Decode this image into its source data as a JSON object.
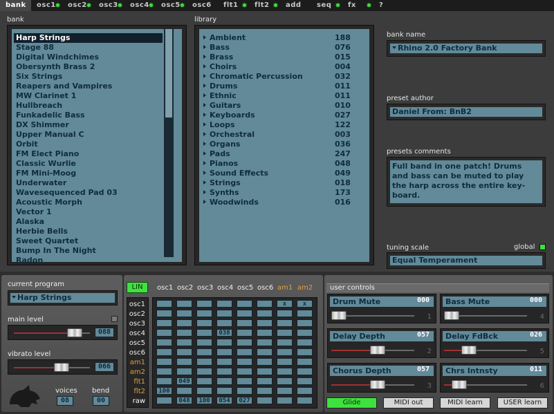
{
  "tabs": [
    {
      "label": "bank",
      "active": true,
      "led": false
    },
    {
      "label": "osc1",
      "active": false,
      "led": true
    },
    {
      "label": "osc2",
      "active": false,
      "led": true
    },
    {
      "label": "osc3",
      "active": false,
      "led": true
    },
    {
      "label": "osc4",
      "active": false,
      "led": true
    },
    {
      "label": "osc5",
      "active": false,
      "led": true
    },
    {
      "label": "osc6",
      "active": false,
      "led": false
    },
    {
      "label": "flt1",
      "active": false,
      "led": true
    },
    {
      "label": "flt2",
      "active": false,
      "led": true
    },
    {
      "label": "add",
      "active": false,
      "led": false
    },
    {
      "label": "seq",
      "active": false,
      "led": true
    },
    {
      "label": "fx",
      "active": false,
      "led": true
    },
    {
      "label": "?",
      "active": false,
      "led": false
    }
  ],
  "bank": {
    "label": "bank",
    "selected_index": 0,
    "items": [
      "Harp Strings",
      "Stage 88",
      "Digital Windchimes",
      "Obersynth Brass 2",
      "Six Strings",
      "Reapers and Vampires",
      "MW Clarinet 1",
      "Hullbreach",
      "Funkadelic Bass",
      "DX Shimmer",
      "Upper Manual C",
      "Orbit",
      "FM Elect Piano",
      "Classic Wurlie",
      "FM Mini-Moog",
      "Underwater",
      "Wavesequenced Pad 03",
      "Acoustic Morph",
      "Vector 1",
      "Alaska",
      "Herbie Bells",
      "Sweet Quartet",
      "Bump In The Night",
      "Radon"
    ]
  },
  "library": {
    "label": "library",
    "items": [
      {
        "name": "Ambient",
        "count": "188"
      },
      {
        "name": "Bass",
        "count": "076"
      },
      {
        "name": "Brass",
        "count": "015"
      },
      {
        "name": "Choirs",
        "count": "004"
      },
      {
        "name": "Chromatic Percussion",
        "count": "032"
      },
      {
        "name": "Drums",
        "count": "011"
      },
      {
        "name": "Ethnic",
        "count": "011"
      },
      {
        "name": "Guitars",
        "count": "010"
      },
      {
        "name": "Keyboards",
        "count": "027"
      },
      {
        "name": "Loops",
        "count": "122"
      },
      {
        "name": "Orchestral",
        "count": "003"
      },
      {
        "name": "Organs",
        "count": "036"
      },
      {
        "name": "Pads",
        "count": "247"
      },
      {
        "name": "Pianos",
        "count": "048"
      },
      {
        "name": "Sound Effects",
        "count": "049"
      },
      {
        "name": "Strings",
        "count": "018"
      },
      {
        "name": "Synths",
        "count": "173"
      },
      {
        "name": "Woodwinds",
        "count": "016"
      }
    ]
  },
  "bank_name": {
    "label": "bank name",
    "value": "Rhino 2.0 Factory Bank"
  },
  "preset_author": {
    "label": "preset author",
    "value": "Daniel   From: BnB2"
  },
  "preset_comments": {
    "label": "presets comments",
    "value": "Full band in one patch!  Drums\nand bass can be muted to play\nthe harp across the entire key-\nboard."
  },
  "tuning_scale": {
    "label": "tuning scale",
    "value": "Equal Temperament",
    "global_label": "global"
  },
  "current_program": {
    "label": "current program",
    "value": "Harp Strings"
  },
  "main_level": {
    "label": "main level",
    "value": "088",
    "level": 0.88
  },
  "vibrato_level": {
    "label": "vibrato level",
    "value": "066",
    "level": 0.66
  },
  "voices": {
    "label": "voices",
    "value": "08"
  },
  "bend": {
    "label": "bend",
    "value": "00"
  },
  "matrix": {
    "mode_label": "LIN",
    "columns": [
      "osc1",
      "osc2",
      "osc3",
      "osc4",
      "osc5",
      "osc6",
      "am1",
      "am2"
    ],
    "rows": [
      "osc1",
      "osc2",
      "osc3",
      "osc4",
      "osc5",
      "osc6",
      "am1",
      "am2",
      "flt1",
      "flt2",
      "raw"
    ],
    "cells": {
      "0.6": "x",
      "0.7": "x",
      "3.3": "038",
      "8.1": "049",
      "9.0": "100",
      "10.1": "048",
      "10.2": "100",
      "10.3": "054",
      "10.4": "027"
    }
  },
  "user_controls": {
    "label": "user controls",
    "controls": [
      {
        "name": "Drum Mute",
        "value": "000",
        "num": "1",
        "level": 0.0
      },
      {
        "name": "Bass Mute",
        "value": "000",
        "num": "4",
        "level": 0.0
      },
      {
        "name": "Delay Depth",
        "value": "057",
        "num": "2",
        "level": 0.57
      },
      {
        "name": "Delay FdBck",
        "value": "026",
        "num": "5",
        "level": 0.26
      },
      {
        "name": "Chorus Depth",
        "value": "057",
        "num": "3",
        "level": 0.57
      },
      {
        "name": "Chrs Intnsty",
        "value": "011",
        "num": "6",
        "level": 0.11
      }
    ]
  },
  "buttons": [
    {
      "label": "Glide",
      "on": true
    },
    {
      "label": "MIDI out",
      "on": false
    },
    {
      "label": "MIDI learn",
      "on": false
    },
    {
      "label": "USER learn",
      "on": false
    }
  ],
  "colors": {
    "display": "#628a99",
    "led_green": "#3ee23e",
    "value_red": "#b02020",
    "value_white": "#ffffff",
    "accent_orange": "#e0a040"
  }
}
